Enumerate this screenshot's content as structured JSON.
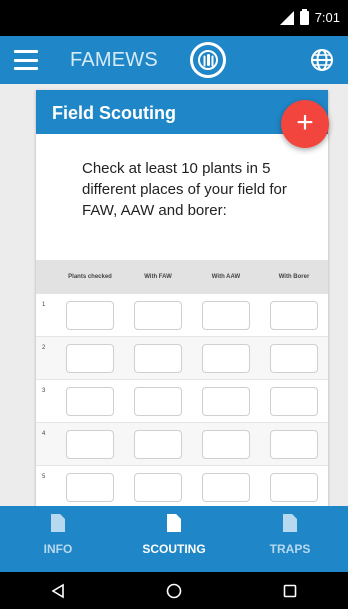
{
  "status_bar": {
    "time": "7:01"
  },
  "app_bar": {
    "title": "FAMEWS",
    "menu_icon": "hamburger-menu-icon",
    "logo_icon": "fao-logo-icon",
    "language_icon": "globe-icon"
  },
  "card": {
    "title": "Field Scouting",
    "fab_label": "+",
    "instruction": "Check at least 10 plants in 5 different places of your field for FAW, AAW and borer:"
  },
  "table": {
    "columns": [
      "Plants checked",
      "With FAW",
      "With AAW",
      "With Borer"
    ],
    "rows": [
      "1",
      "2",
      "3",
      "4",
      "5"
    ]
  },
  "bottom_nav": {
    "items": [
      {
        "label": "INFO",
        "icon": "document-icon",
        "active": false
      },
      {
        "label": "SCOUTING",
        "icon": "document-icon",
        "active": true
      },
      {
        "label": "TRAPS",
        "icon": "document-icon",
        "active": false
      }
    ]
  },
  "colors": {
    "primary": "#1f86c7",
    "fab": "#f2453d"
  }
}
